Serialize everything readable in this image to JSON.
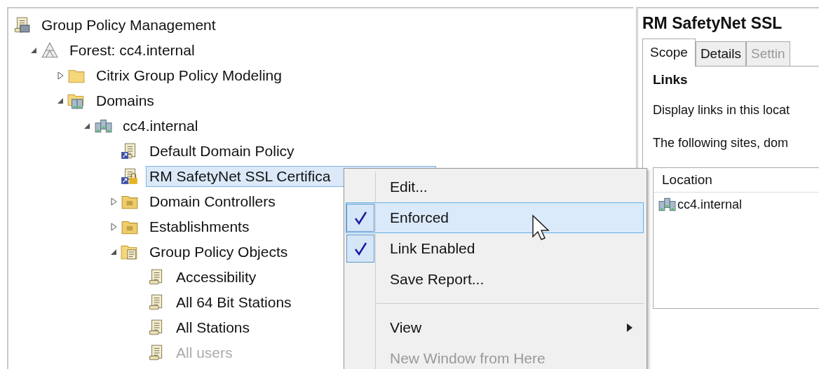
{
  "tree": [
    {
      "label": "Group Policy Management",
      "kind": "root",
      "children": [
        {
          "label": "Forest: cc4.internal",
          "kind": "forest",
          "expanded": true,
          "children": [
            {
              "label": "Citrix Group Policy Modeling",
              "kind": "folder",
              "expanded": false
            },
            {
              "label": "Domains",
              "kind": "domains",
              "expanded": true,
              "children": [
                {
                  "label": "cc4.internal",
                  "kind": "domain",
                  "expanded": true,
                  "children": [
                    {
                      "label": "Default Domain Policy",
                      "kind": "gpo-link",
                      "selected": false
                    },
                    {
                      "label": "RM SafetyNet SSL Certifica",
                      "kind": "gpo-link-locked",
                      "selected": true
                    },
                    {
                      "label": "Domain Controllers",
                      "kind": "ou",
                      "expanded": false
                    },
                    {
                      "label": "Establishments",
                      "kind": "ou",
                      "expanded": false
                    },
                    {
                      "label": "Group Policy Objects",
                      "kind": "gpo-folder",
                      "expanded": true,
                      "children": [
                        {
                          "label": "Accessibility",
                          "kind": "gpo",
                          "dimmed": false
                        },
                        {
                          "label": "All 64 Bit Stations",
                          "kind": "gpo",
                          "dimmed": false
                        },
                        {
                          "label": "All Stations",
                          "kind": "gpo",
                          "dimmed": false
                        },
                        {
                          "label": "All users",
                          "kind": "gpo",
                          "dimmed": true
                        }
                      ]
                    }
                  ]
                }
              ]
            }
          ]
        }
      ]
    }
  ],
  "details": {
    "title": "RM SafetyNet SSL",
    "tabs": [
      {
        "label": "Scope",
        "selected": true
      },
      {
        "label": "Details",
        "selected": false
      },
      {
        "label": "Settin",
        "selected": false
      }
    ],
    "section": "Links",
    "line_1": "Display links in this locat",
    "line_2": "The following sites, dom",
    "table": {
      "columns": [
        "Location"
      ],
      "rows": [
        {
          "location": "cc4.internal"
        }
      ]
    }
  },
  "context_menu": [
    {
      "kind": "item",
      "label": "Edit...",
      "checked": false,
      "selected": false,
      "disabled": false
    },
    {
      "kind": "item",
      "label": "Enforced",
      "checked": true,
      "selected": true,
      "disabled": false
    },
    {
      "kind": "item",
      "label": "Link Enabled",
      "checked": true,
      "selected": false,
      "disabled": false
    },
    {
      "kind": "item",
      "label": "Save Report...",
      "checked": false,
      "selected": false,
      "disabled": false
    },
    {
      "kind": "separator"
    },
    {
      "kind": "submenu",
      "label": "View",
      "checked": false,
      "selected": false,
      "disabled": false
    },
    {
      "kind": "item",
      "label": "New Window from Here",
      "checked": false,
      "selected": false,
      "disabled": true
    }
  ]
}
